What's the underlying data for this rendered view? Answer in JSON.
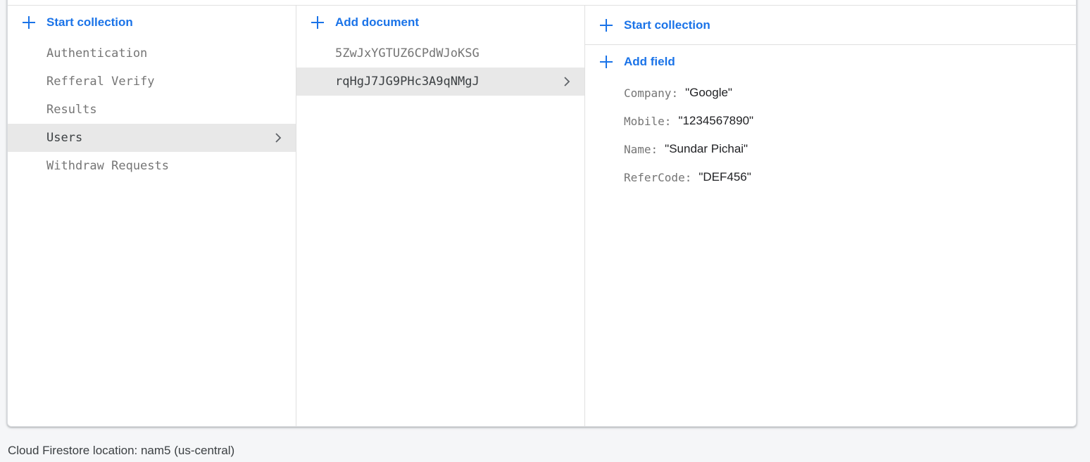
{
  "collections_panel": {
    "action_label": "Start collection",
    "items": [
      {
        "label": "Authentication",
        "selected": false
      },
      {
        "label": "Refferal Verify",
        "selected": false
      },
      {
        "label": "Results",
        "selected": false
      },
      {
        "label": "Users",
        "selected": true
      },
      {
        "label": "Withdraw Requests",
        "selected": false
      }
    ]
  },
  "documents_panel": {
    "action_label": "Add document",
    "items": [
      {
        "label": "5ZwJxYGTUZ6CPdWJoKSG",
        "selected": false
      },
      {
        "label": "rqHgJ7JG9PHc3A9qNMgJ",
        "selected": true
      }
    ]
  },
  "document_panel": {
    "start_collection_label": "Start collection",
    "add_field_label": "Add field",
    "fields": [
      {
        "key": "Company",
        "value": "\"Google\""
      },
      {
        "key": "Mobile",
        "value": "\"1234567890\""
      },
      {
        "key": "Name",
        "value": "\"Sundar Pichai\""
      },
      {
        "key": "ReferCode",
        "value": "\"DEF456\""
      }
    ]
  },
  "footer": {
    "location_text": "Cloud Firestore location: nam5 (us-central)"
  },
  "colors": {
    "accent": "#1a73e8",
    "selected_bg": "#e8e8e8",
    "page_bg": "#f5f6f8"
  },
  "icons": {
    "add": "plus-icon",
    "open": "chevron-right-icon"
  }
}
